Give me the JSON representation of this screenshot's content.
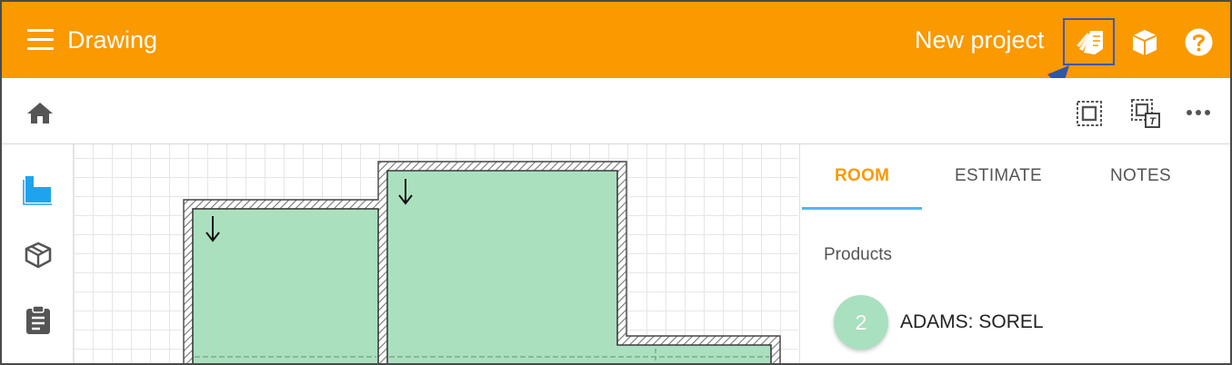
{
  "app": {
    "title": "Drawing",
    "project_name": "New project",
    "accent_color": "#fa9900",
    "icons": [
      "menu-icon",
      "drawing-sheets-icon",
      "3d-view-icon",
      "help-icon"
    ]
  },
  "toolbar": {
    "icons": [
      "home-icon",
      "select-frame-icon",
      "select-text-frame-icon",
      "more-options-icon"
    ]
  },
  "sidebar": {
    "items": [
      {
        "icon": "floor-plan-icon",
        "active": true
      },
      {
        "icon": "products-box-icon",
        "active": false
      },
      {
        "icon": "clipboard-icon",
        "active": false
      }
    ]
  },
  "panel": {
    "tabs": [
      {
        "label": "ROOM",
        "active": true
      },
      {
        "label": "ESTIMATE",
        "active": false
      },
      {
        "label": "NOTES",
        "active": false
      }
    ],
    "products_label": "Products",
    "products": [
      {
        "count": "2",
        "name": "ADAMS: SOREL"
      }
    ]
  }
}
